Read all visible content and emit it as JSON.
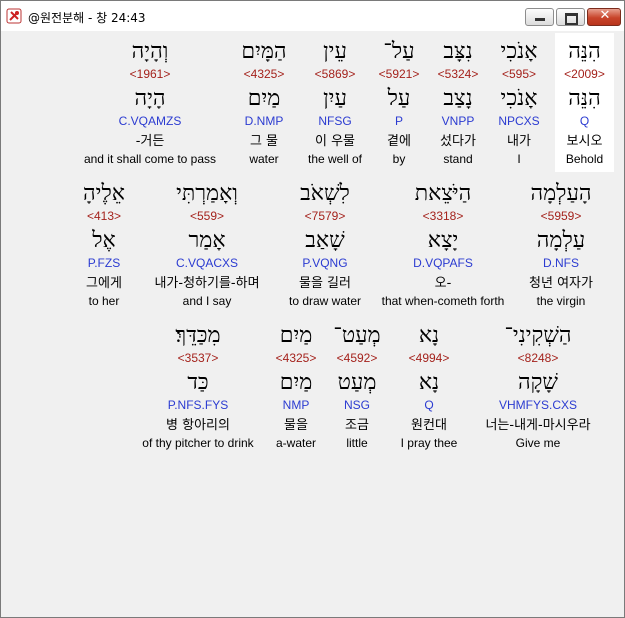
{
  "window": {
    "title": "@원전분해 - 창 24:43",
    "minimize_label": "",
    "maximize_label": "",
    "close_label": "✕"
  },
  "rows": [
    {
      "words": [
        {
          "hebrew": "וְהָיָה",
          "strong": "<1961>",
          "lemma": "הָיָה",
          "morph": "C.VQAMZS",
          "korean": "-거든",
          "english": "and it shall come to pass"
        },
        {
          "hebrew": "הַמָּיִם",
          "strong": "<4325>",
          "lemma": "מַיִם",
          "morph": "D.NMP",
          "korean": "그 물",
          "english": "water"
        },
        {
          "hebrew": "עֵין",
          "strong": "<5869>",
          "lemma": "עַיִן",
          "morph": "NFSG",
          "korean": "이 우물",
          "english": "the well of"
        },
        {
          "hebrew": "עַל־",
          "strong": "<5921>",
          "lemma": "עַל",
          "morph": "P",
          "korean": "곁에",
          "english": "by"
        },
        {
          "hebrew": "נִצָּב",
          "strong": "<5324>",
          "lemma": "נָצַב",
          "morph": "VNPP",
          "korean": "섰다가",
          "english": "stand"
        },
        {
          "hebrew": "אָנֹכִי",
          "strong": "<595>",
          "lemma": "אָנֹכִי",
          "morph": "NPCXS",
          "korean": "내가",
          "english": "I"
        },
        {
          "hebrew": "הִנֵּה",
          "strong": "<2009>",
          "lemma": "הִנֵּה",
          "morph": "Q",
          "korean": "보시오",
          "english": "Behold"
        }
      ]
    },
    {
      "words": [
        {
          "hebrew": "אֵלֶיהָ",
          "strong": "<413>",
          "lemma": "אֶל",
          "morph": "P.FZS",
          "korean": "그에게",
          "english": "to her"
        },
        {
          "hebrew": "וְאָמַרְתִּי",
          "strong": "<559>",
          "lemma": "אָמַר",
          "morph": "C.VQACXS",
          "korean": "내가-청하기를-하며",
          "english": "and I say"
        },
        {
          "hebrew": "לִשְׁאֹב",
          "strong": "<7579>",
          "lemma": "שָׁאַב",
          "morph": "P.VQNG",
          "korean": "물을 길러",
          "english": "to draw water"
        },
        {
          "hebrew": "הַיֹּצֵאת",
          "strong": "<3318>",
          "lemma": "יָצָא",
          "morph": "D.VQPAFS",
          "korean": "오-",
          "english": "that when-cometh forth"
        },
        {
          "hebrew": "הָעַלְמָה",
          "strong": "<5959>",
          "lemma": "עַלְמָה",
          "morph": "D.NFS",
          "korean": "청년 여자가",
          "english": "the virgin"
        }
      ]
    },
    {
      "words": [
        {
          "hebrew": "מִכַּדֵּךְ׃",
          "strong": "<3537>",
          "lemma": "כַּד",
          "morph": "P.NFS.FYS",
          "korean": "병 항아리의",
          "english": "of thy pitcher to drink"
        },
        {
          "hebrew": "מַיִם",
          "strong": "<4325>",
          "lemma": "מַיִם",
          "morph": "NMP",
          "korean": "물을",
          "english": "a-water"
        },
        {
          "hebrew": "מְעַט־",
          "strong": "<4592>",
          "lemma": "מְעַט",
          "morph": "NSG",
          "korean": "조금",
          "english": "little"
        },
        {
          "hebrew": "נָא",
          "strong": "<4994>",
          "lemma": "נָא",
          "morph": "Q",
          "korean": "원컨대",
          "english": "I pray thee"
        },
        {
          "hebrew": "הַשְׁקִינִי־",
          "strong": "<8248>",
          "lemma": "שָׁקָה",
          "morph": "VHMFYS.CXS",
          "korean": "너는-내게-마시우라",
          "english": "Give me"
        }
      ]
    }
  ]
}
